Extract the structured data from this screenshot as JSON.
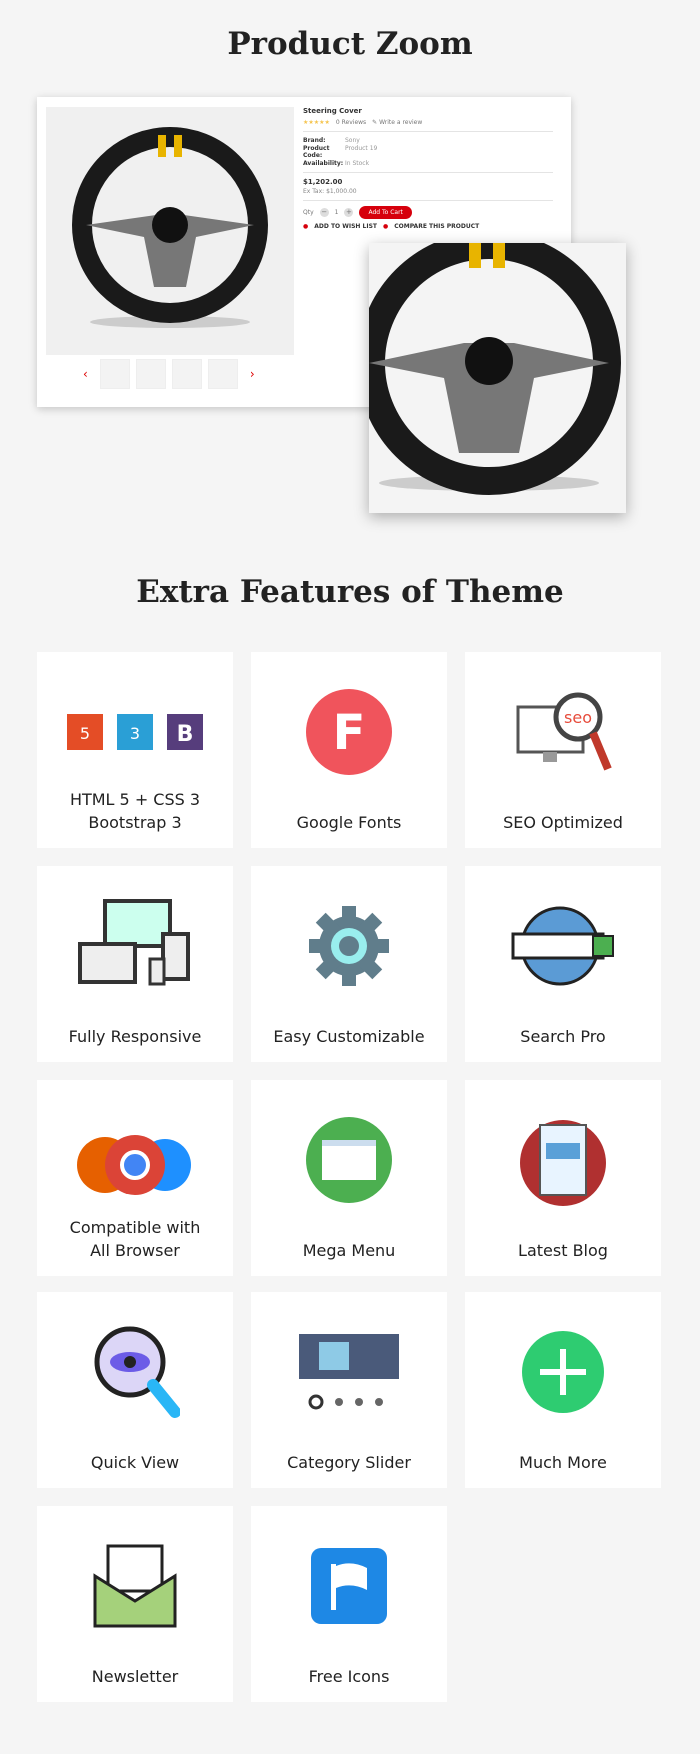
{
  "section1": {
    "title": "Product Zoom"
  },
  "product": {
    "name": "Steering Cover",
    "reviews": "0 Reviews",
    "write_review": "Write a review",
    "brand_label": "Brand:",
    "brand": "Sony",
    "code_label": "Product Code:",
    "code": "Product 19",
    "avail_label": "Availability:",
    "avail": "In Stock",
    "price": "$1,202.00",
    "ex_tax": "Ex Tax: $1,000.00",
    "qty_label": "Qty",
    "qty": "1",
    "add_to_cart": "Add To Cart",
    "wishlist": "ADD TO WISH LIST",
    "compare": "COMPARE THIS PRODUCT",
    "minus": "−",
    "plus": "+",
    "prev": "‹",
    "next": "›",
    "rating": 0,
    "accent": "#d6000c"
  },
  "section2": {
    "title": "Extra Features of Theme"
  },
  "features": [
    {
      "label": "HTML 5 + CSS 3\nBootstrap 3",
      "icon": "html-css-bootstrap-icon"
    },
    {
      "label": "Google Fonts",
      "icon": "google-fonts-icon"
    },
    {
      "label": "SEO Optimized",
      "icon": "seo-icon"
    },
    {
      "label": "Fully Responsive",
      "icon": "responsive-devices-icon"
    },
    {
      "label": "Easy Customizable",
      "icon": "gear-icon"
    },
    {
      "label": "Search Pro",
      "icon": "globe-search-icon"
    },
    {
      "label": "Compatible with\nAll Browser",
      "icon": "browsers-icon"
    },
    {
      "label": "Mega Menu",
      "icon": "mega-menu-icon"
    },
    {
      "label": "Latest Blog",
      "icon": "blog-icon"
    },
    {
      "label": "Quick View",
      "icon": "magnifier-eye-icon"
    },
    {
      "label": "Category Slider",
      "icon": "slider-icon"
    },
    {
      "label": "Much More",
      "icon": "plus-icon"
    },
    {
      "label": "Newsletter",
      "icon": "envelope-icon"
    },
    {
      "label": "Free Icons",
      "icon": "flag-icon"
    }
  ]
}
